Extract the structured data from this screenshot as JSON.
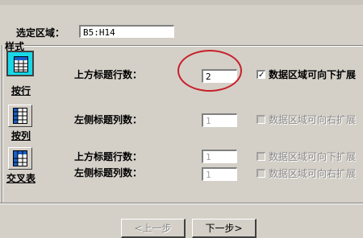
{
  "selection": {
    "label": "选定区域：",
    "value": "B5:H14"
  },
  "style_group": {
    "title": "样式"
  },
  "style_buttons": [
    {
      "caption": "按行",
      "active": true
    },
    {
      "caption": "按列",
      "active": false
    },
    {
      "caption": "交叉表",
      "active": false
    }
  ],
  "rows": {
    "top_header_rows": {
      "label": "上方标题行数：",
      "value": "2",
      "enabled": true
    },
    "left_header_cols": {
      "label": "左侧标题列数：",
      "value": "1",
      "enabled": false
    },
    "cross_top_rows": {
      "label": "上方标题行数：",
      "value": "1",
      "enabled": false
    },
    "cross_left_cols": {
      "label": "左侧标题列数：",
      "value": "1",
      "enabled": false
    }
  },
  "checkboxes": {
    "expand_down": {
      "label": "数据区域可向下扩展",
      "checked": true,
      "enabled": true
    },
    "expand_right": {
      "label": "数据区域可向右扩展",
      "checked": false,
      "enabled": false
    },
    "cross_expand_down": {
      "label": "数据区域可向下扩展",
      "checked": false,
      "enabled": false
    },
    "cross_expand_right": {
      "label": "数据区域可向右扩展",
      "checked": false,
      "enabled": false
    }
  },
  "navigation": {
    "prev_label": "<上一步",
    "next_label": "下一步>"
  },
  "colors": {
    "active_button": "#18d8e8",
    "highlight_ring": "#c8202a",
    "dialog_bg": "#d4d0c8"
  },
  "icons": [
    "grid-icon",
    "grid-icon",
    "grid-icon",
    "checkmark-icon"
  ]
}
